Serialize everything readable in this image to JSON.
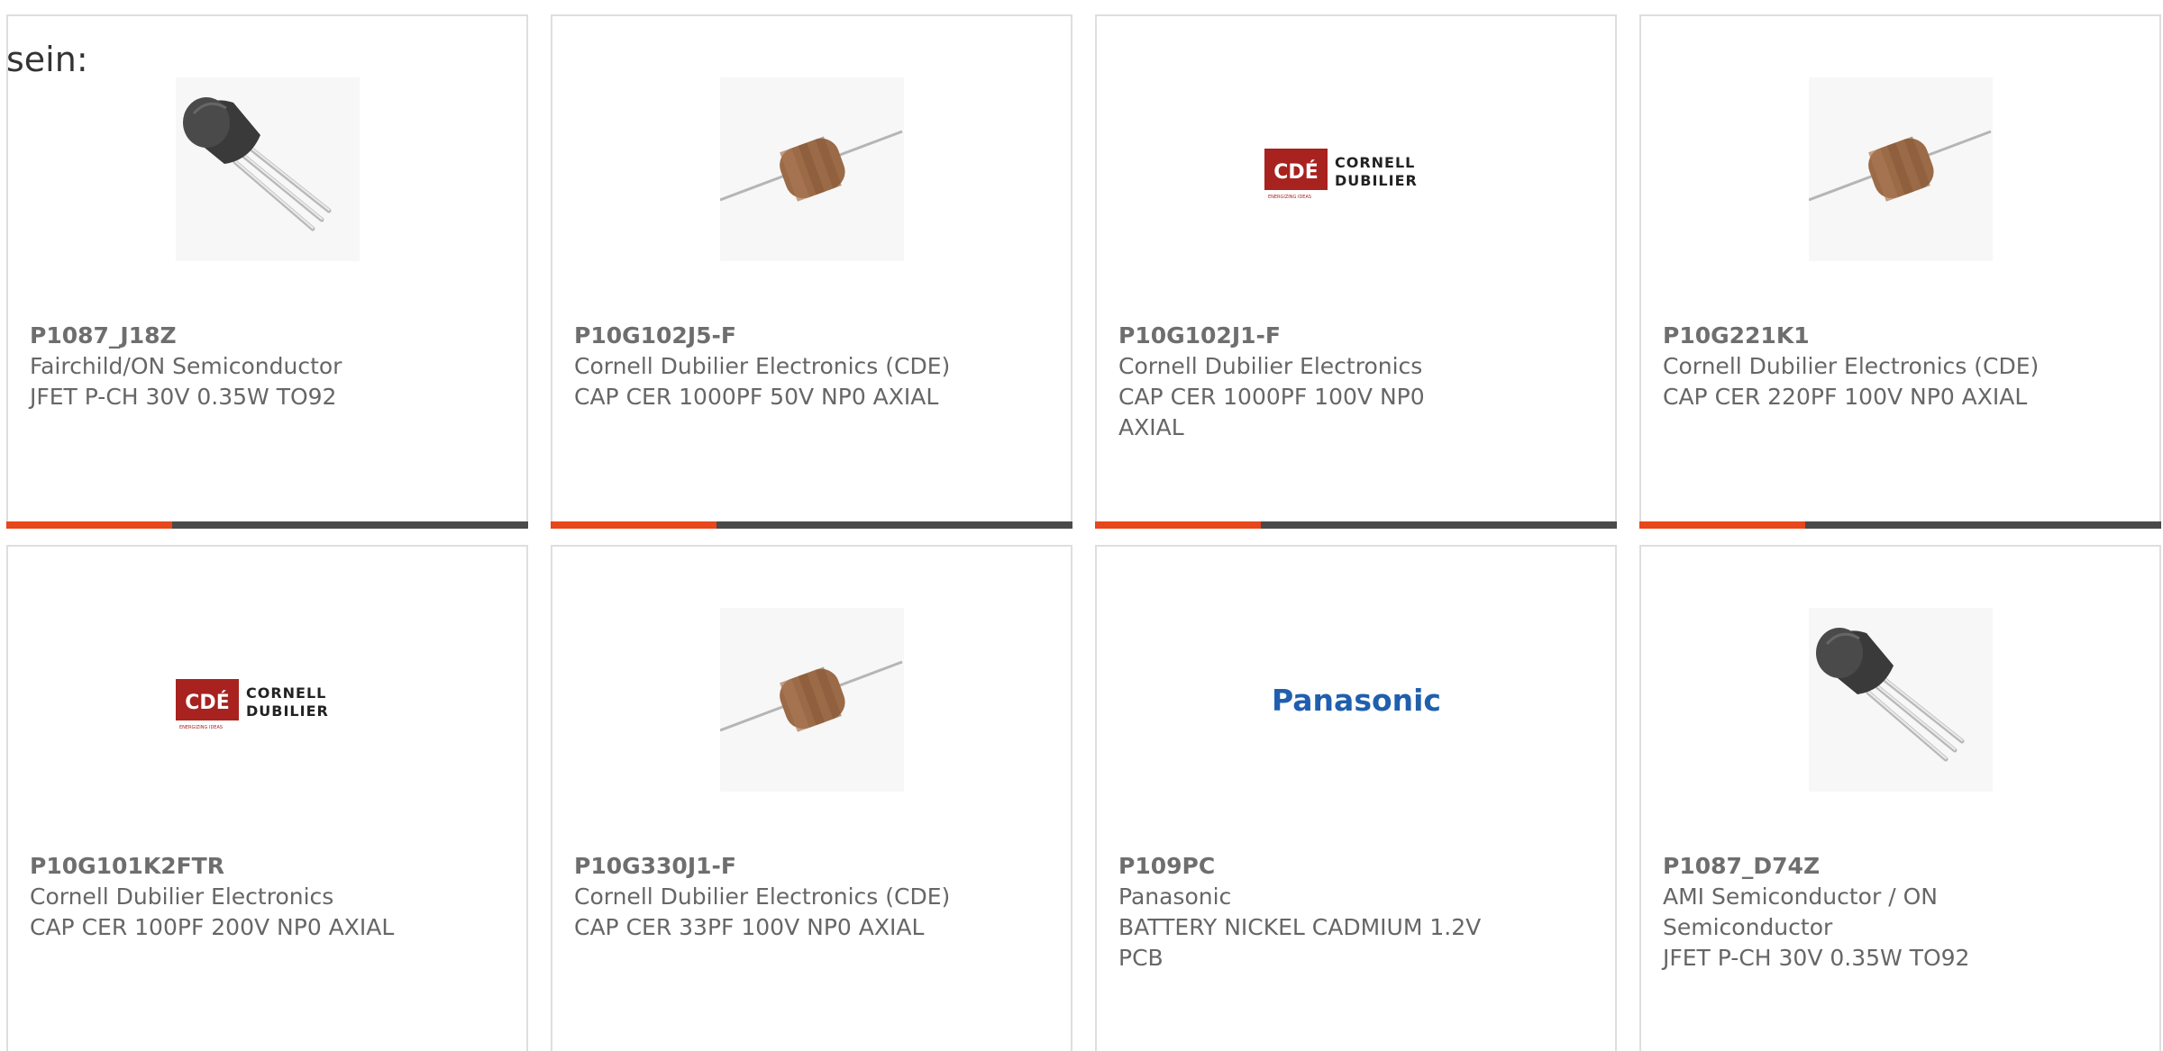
{
  "prefix_text": "sein:",
  "accent_color": "#e8461b",
  "progress_fraction": 0.317,
  "cards": [
    {
      "part": "P1087_J18Z",
      "manufacturer": "Fairchild/ON Semiconductor",
      "description": "JFET P-CH 30V 0.35W TO92",
      "image": "to92-transistor",
      "has_progress_bar": true
    },
    {
      "part": "P10G102J5-F",
      "manufacturer": "Cornell Dubilier Electronics (CDE)",
      "description": "CAP CER 1000PF 50V NP0 AXIAL",
      "image": "axial-capacitor",
      "has_progress_bar": true
    },
    {
      "part": "P10G102J1-F",
      "manufacturer": "Cornell Dubilier Electronics",
      "description": "CAP CER 1000PF 100V NP0 AXIAL",
      "image": "cde-logo",
      "has_progress_bar": true
    },
    {
      "part": "P10G221K1",
      "manufacturer": "Cornell Dubilier Electronics (CDE)",
      "description": "CAP CER 220PF 100V NP0 AXIAL",
      "image": "axial-capacitor",
      "has_progress_bar": true
    },
    {
      "part": "P10G101K2FTR",
      "manufacturer": "Cornell Dubilier Electronics",
      "description": "CAP CER 100PF 200V NP0 AXIAL",
      "image": "cde-logo",
      "has_progress_bar": false
    },
    {
      "part": "P10G330J1-F",
      "manufacturer": "Cornell Dubilier Electronics (CDE)",
      "description": "CAP CER 33PF 100V NP0 AXIAL",
      "image": "axial-capacitor",
      "has_progress_bar": false
    },
    {
      "part": "P109PC",
      "manufacturer": "Panasonic",
      "description": "BATTERY NICKEL CADMIUM 1.2V PCB",
      "image": "panasonic-logo",
      "has_progress_bar": false
    },
    {
      "part": "P1087_D74Z",
      "manufacturer": "AMI Semiconductor / ON Semiconductor",
      "description": "JFET P-CH 30V 0.35W TO92",
      "image": "to92-transistor",
      "has_progress_bar": false
    }
  ],
  "logos": {
    "cde_mark": "CDÉ",
    "cde_word1": "CORNELL",
    "cde_word2": "DUBILIER",
    "cde_tagline": "ENERGIZING IDEAS",
    "panasonic": "Panasonic",
    "cde_red": "#a8221f",
    "panasonic_blue": "#1f5fae"
  }
}
